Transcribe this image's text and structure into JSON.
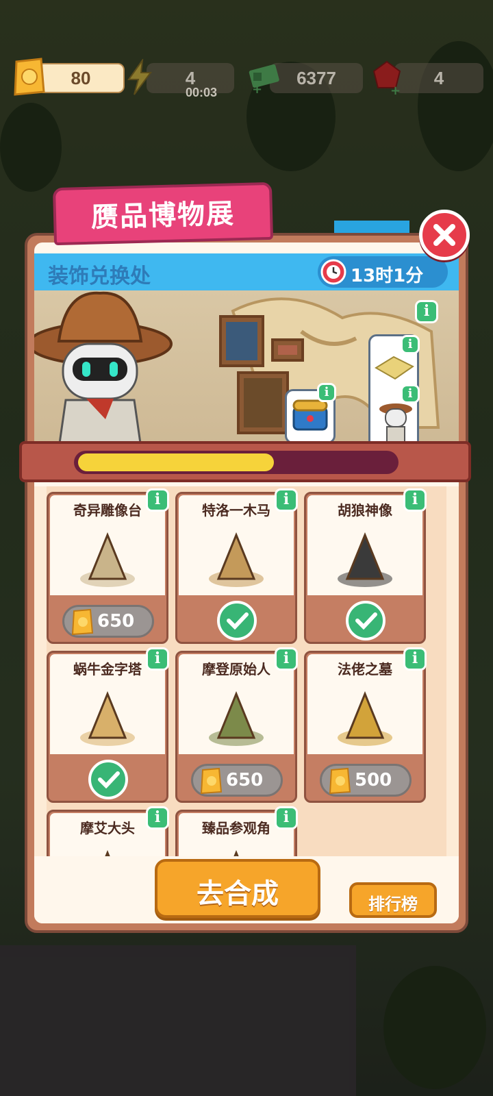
{
  "top_bar": {
    "ticket_value": "80",
    "energy_value": "4",
    "energy_timer": "00:03",
    "cash_value": "6377",
    "gem_value": "4"
  },
  "panel": {
    "title": "赝品博物展",
    "subtitle": "装饰兑换处",
    "countdown": "13时1分",
    "progress_fraction": 0.62
  },
  "items": [
    {
      "name": "奇异雕像台",
      "price": "650",
      "owned": false
    },
    {
      "name": "特洛一木马",
      "price": "",
      "owned": true
    },
    {
      "name": "胡狼神像",
      "price": "",
      "owned": true
    },
    {
      "name": "蜗牛金字塔",
      "price": "",
      "owned": true
    },
    {
      "name": "摩登原始人",
      "price": "650",
      "owned": false
    },
    {
      "name": "法佬之墓",
      "price": "500",
      "owned": false
    },
    {
      "name": "摩艾大头",
      "price": "",
      "owned": false
    },
    {
      "name": "臻品参观角",
      "price": "",
      "owned": false
    }
  ],
  "buttons": {
    "synthesize": "去合成",
    "leaderboard": "排行榜"
  },
  "colors": {
    "title_pink": "#e8427a",
    "header_blue": "#3fb8f0",
    "check_green": "#38b575",
    "button_orange": "#f6a52a",
    "progress_yellow": "#f6d33a"
  }
}
